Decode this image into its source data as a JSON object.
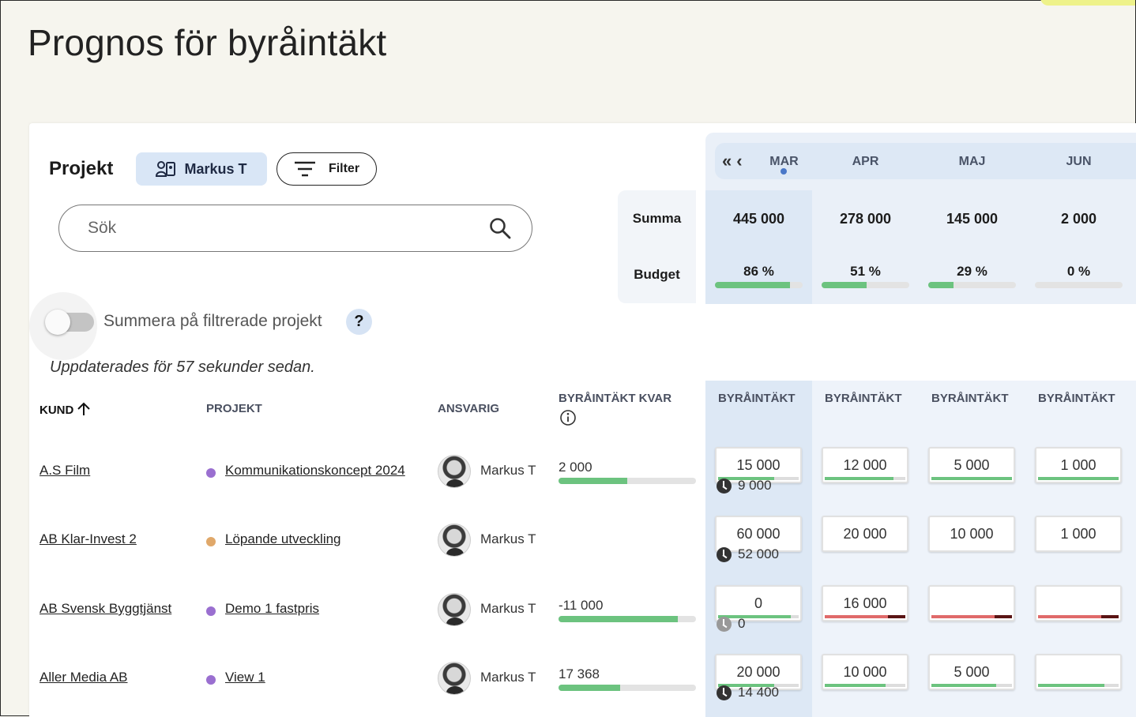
{
  "page": {
    "title": "Prognos för byråintäkt"
  },
  "toolbar": {
    "projekt_label": "Projekt",
    "user_filter": "Markus T",
    "filter_label": "Filter",
    "search_placeholder": "Sök"
  },
  "toggle": {
    "label": "Summera på filtrerade projekt",
    "help": "?",
    "on": false
  },
  "updated_text": "Uppdaterades för 57 sekunder sedan.",
  "summary": {
    "summa_label": "Summa",
    "budget_label": "Budget",
    "months": [
      {
        "name": "MAR",
        "summa": "445 000",
        "budget_pct": "86 %",
        "budget_fill": 0.86
      },
      {
        "name": "APR",
        "summa": "278 000",
        "budget_pct": "51 %",
        "budget_fill": 0.51
      },
      {
        "name": "MAJ",
        "summa": "145 000",
        "budget_pct": "29 %",
        "budget_fill": 0.29
      },
      {
        "name": "JUN",
        "summa": "2 000",
        "budget_pct": "0 %",
        "budget_fill": 0.0
      }
    ]
  },
  "table": {
    "headers": {
      "kund": "KUND",
      "projekt": "PROJEKT",
      "ansvarig": "ANSVARIG",
      "kvar": "BYRÅINTÄKT KVAR",
      "month_col": "BYRÅINTÄKT"
    },
    "rows": [
      {
        "kund": "A.S Film",
        "projekt": "Kommunikationskoncept 2024",
        "dot_color": "#9a6fd0",
        "ansvarig": "Markus T",
        "kvar": "2 000",
        "kvar_fill": 0.5,
        "months": [
          {
            "value": "15 000",
            "fill": 0.7,
            "over": false
          },
          {
            "value": "12 000",
            "fill": 0.85,
            "over": false
          },
          {
            "value": "5 000",
            "fill": 1.0,
            "over": false
          },
          {
            "value": "1 000",
            "fill": 1.0,
            "over": false
          }
        ],
        "actual": "9 000",
        "actual_dim": false
      },
      {
        "kund": "AB Klar-Invest 2",
        "projekt": "Löpande utveckling",
        "dot_color": "#e0a86a",
        "ansvarig": "Markus T",
        "kvar": "",
        "kvar_fill": null,
        "months": [
          {
            "value": "60 000",
            "fill": null,
            "over": false
          },
          {
            "value": "20 000",
            "fill": null,
            "over": false
          },
          {
            "value": "10 000",
            "fill": null,
            "over": false
          },
          {
            "value": "1 000",
            "fill": null,
            "over": false
          }
        ],
        "actual": "52 000",
        "actual_dim": false
      },
      {
        "kund": "AB Svensk Byggtjänst",
        "projekt": "Demo 1 fastpris",
        "dot_color": "#9a6fd0",
        "ansvarig": "Markus T",
        "kvar": "-11 000",
        "kvar_fill": 0.87,
        "months": [
          {
            "value": "0",
            "fill": 0.9,
            "over": false
          },
          {
            "value": "16 000",
            "fill": 0.78,
            "over": true
          },
          {
            "value": "",
            "fill": 0.78,
            "over": true
          },
          {
            "value": "",
            "fill": 0.78,
            "over": true
          }
        ],
        "actual": "0",
        "actual_dim": true
      },
      {
        "kund": "Aller Media AB",
        "projekt": "View 1",
        "dot_color": "#9a6fd0",
        "ansvarig": "Markus T",
        "kvar": "17 368",
        "kvar_fill": 0.45,
        "months": [
          {
            "value": "20 000",
            "fill": 0.7,
            "over": false
          },
          {
            "value": "10 000",
            "fill": 0.75,
            "over": false
          },
          {
            "value": "5 000",
            "fill": 0.8,
            "over": false
          },
          {
            "value": "",
            "fill": 0.82,
            "over": false
          }
        ],
        "actual": "14 400",
        "actual_dim": false
      }
    ]
  }
}
